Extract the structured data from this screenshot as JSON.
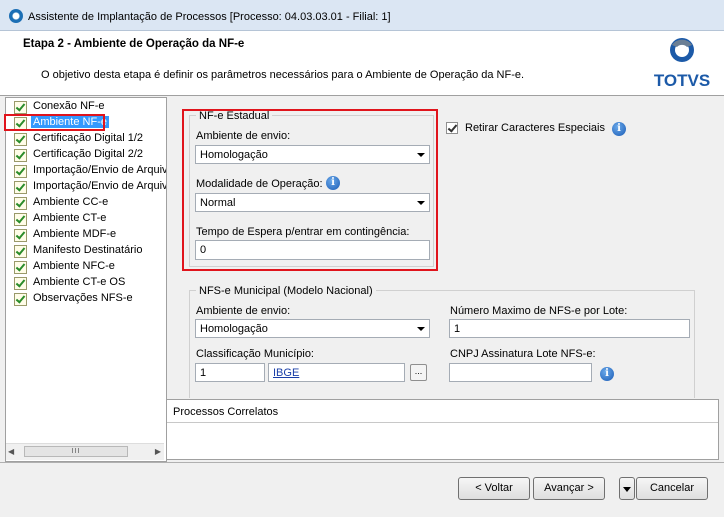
{
  "window": {
    "title": "Assistente de Implantação de Processos [Processo: 04.03.03.01 - Filial: 1]"
  },
  "header": {
    "step_title": "Etapa 2 - Ambiente de Operação da NF-e",
    "description": "O objetivo desta etapa é definir os parâmetros necessários para o Ambiente de Operação da NF-e.",
    "brand": "TOTVS"
  },
  "tree": {
    "items": [
      {
        "label": "Conexão NF-e",
        "selected": false
      },
      {
        "label": "Ambiente NF-e",
        "selected": true
      },
      {
        "label": "Certificação Digital 1/2",
        "selected": false
      },
      {
        "label": "Certificação Digital 2/2",
        "selected": false
      },
      {
        "label": "Importação/Envio de Arquiv",
        "selected": false
      },
      {
        "label": "Importação/Envio de Arquiv",
        "selected": false
      },
      {
        "label": "Ambiente CC-e",
        "selected": false
      },
      {
        "label": "Ambiente CT-e",
        "selected": false
      },
      {
        "label": "Ambiente MDF-e",
        "selected": false
      },
      {
        "label": "Manifesto Destinatário",
        "selected": false
      },
      {
        "label": "Ambiente NFC-e",
        "selected": false
      },
      {
        "label": "Ambiente CT-e OS",
        "selected": false
      },
      {
        "label": "Observações NFS-e",
        "selected": false
      }
    ]
  },
  "nfe_estadual": {
    "group_title": "NF-e Estadual",
    "ambiente_label": "Ambiente de envio:",
    "ambiente_value": "Homologação",
    "modalidade_label": "Modalidade de Operação:",
    "modalidade_value": "Normal",
    "tempo_label": "Tempo de Espera p/entrar em contingência:",
    "tempo_value": "0"
  },
  "retirar": {
    "label": "Retirar Caracteres Especiais",
    "checked": true
  },
  "nfse": {
    "group_title": "NFS-e Municipal (Modelo Nacional)",
    "ambiente_label": "Ambiente de envio:",
    "ambiente_value": "Homologação",
    "numero_label": "Número Maximo de NFS-e por Lote:",
    "numero_value": "1",
    "classificacao_label": "Classificação Município:",
    "classificacao_value": "1",
    "ibge_link": "IBGE",
    "browse_label": "...",
    "cnpj_label": "CNPJ Assinatura Lote NFS-e:",
    "cnpj_value": ""
  },
  "processos": {
    "title": "Processos Correlatos"
  },
  "buttons": {
    "voltar": "< Voltar",
    "avancar": "Avançar >",
    "cancelar": "Cancelar"
  },
  "colors": {
    "highlight_red": "#e0141c",
    "selection_blue": "#3399ff",
    "brand_blue": "#1c5aa8"
  }
}
